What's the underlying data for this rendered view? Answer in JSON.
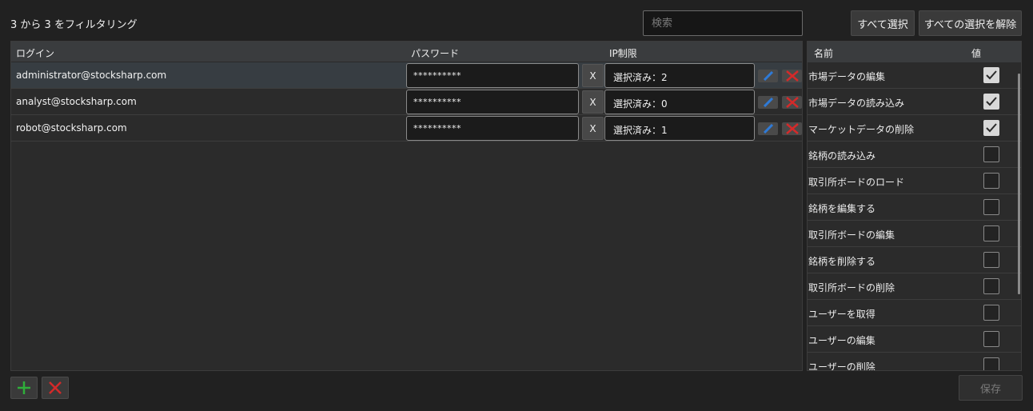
{
  "toolbar": {
    "filter_status": "3 から 3 をフィルタリング",
    "search_placeholder": "検索",
    "select_all_label": "すべて選択",
    "deselect_all_label": "すべての選択を解除"
  },
  "users_grid": {
    "columns": {
      "login": "ログイン",
      "password": "パスワード",
      "ip": "IP制限"
    },
    "rows": [
      {
        "login": "administrator@stocksharp.com",
        "password": "**********",
        "clear": "X",
        "ip": "選択済み：2",
        "selected": true
      },
      {
        "login": "analyst@stocksharp.com",
        "password": "**********",
        "clear": "X",
        "ip": "選択済み：0",
        "selected": false
      },
      {
        "login": "robot@stocksharp.com",
        "password": "**********",
        "clear": "X",
        "ip": "選択済み：1",
        "selected": false
      }
    ]
  },
  "permissions_grid": {
    "columns": {
      "name": "名前",
      "value": "値"
    },
    "rows": [
      {
        "name": "市場データの編集",
        "checked": true
      },
      {
        "name": "市場データの読み込み",
        "checked": true
      },
      {
        "name": "マーケットデータの削除",
        "checked": true
      },
      {
        "name": "銘柄の読み込み",
        "checked": false
      },
      {
        "name": "取引所ボードのロード",
        "checked": false
      },
      {
        "name": "銘柄を編集する",
        "checked": false
      },
      {
        "name": "取引所ボードの編集",
        "checked": false
      },
      {
        "name": "銘柄を削除する",
        "checked": false
      },
      {
        "name": "取引所ボードの削除",
        "checked": false
      },
      {
        "name": "ユーザーを取得",
        "checked": false
      },
      {
        "name": "ユーザーの編集",
        "checked": false
      },
      {
        "name": "ユーザーの削除",
        "checked": false
      }
    ]
  },
  "footer": {
    "save_label": "保存"
  },
  "colors": {
    "edit_icon": "#2f7ad6",
    "delete_icon": "#d42a2a",
    "add_icon": "#2fae3a"
  }
}
